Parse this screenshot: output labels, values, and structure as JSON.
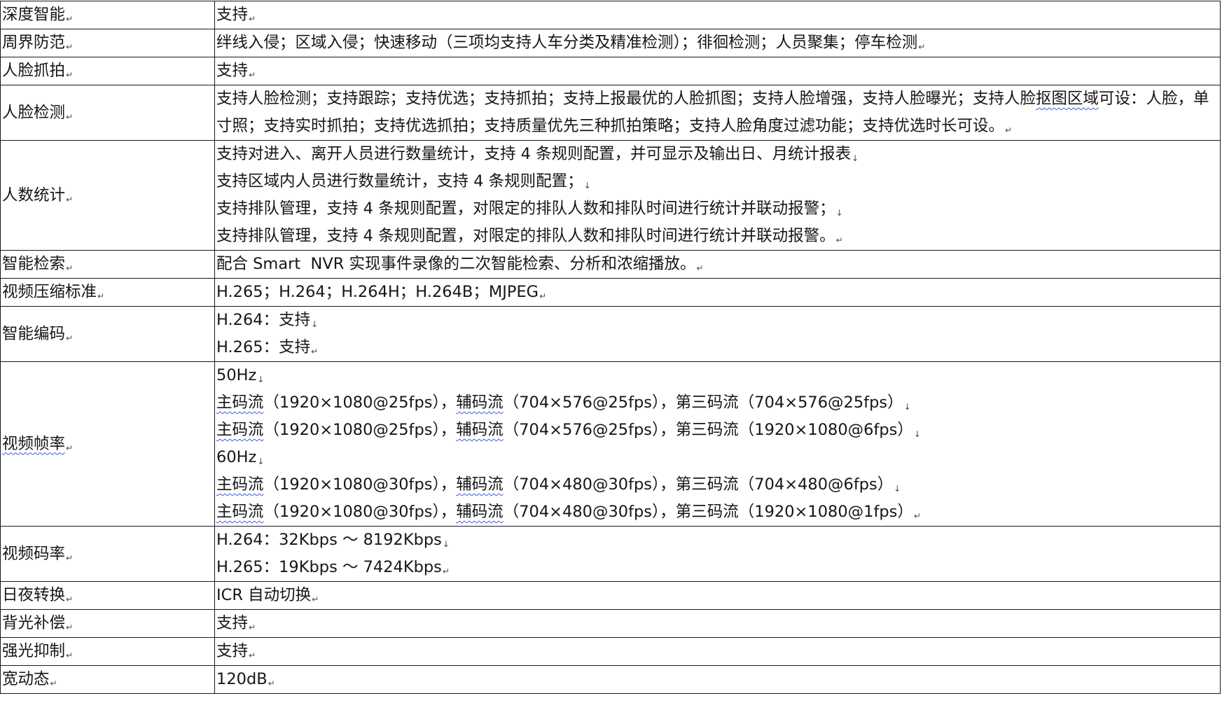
{
  "table": {
    "rows": [
      {
        "label": "深度智能",
        "lines": [
          "支持"
        ]
      },
      {
        "label": "周界防范",
        "lines": [
          "绊线入侵；区域入侵；快速移动（三项均支持人车分类及精准检测）；徘徊检测；人员聚集；停车检测"
        ]
      },
      {
        "label": "人脸抓拍",
        "lines": [
          "支持"
        ]
      },
      {
        "label": "人脸检测",
        "lines": [
          [
            "支持人脸检测；支持跟踪；支持优选；支持抓拍；支持上报最优的人脸抓图；支持人脸增强，支持人脸曝光；支持人脸",
            "抠图区域",
            "可设：人脸，单寸照；支持实时抓拍；支持优选抓拍；支持质量优先三种抓拍策略；支持人脸角度过滤功能；支持优选时长可设。"
          ]
        ]
      },
      {
        "label": "人数统计",
        "lines": [
          "支持对进入、离开人员进行数量统计，支持 4 条规则配置，并可显示及输出日、月统计报表",
          "支持区域内人员进行数量统计，支持 4 条规则配置；",
          "支持排队管理，支持 4 条规则配置，对限定的排队人数和排队时间进行统计并联动报警；",
          "支持排队管理，支持 4 条规则配置，对限定的排队人数和排队时间进行统计并联动报警。"
        ]
      },
      {
        "label": "智能检索",
        "lines": [
          "配合 Smart  NVR 实现事件录像的二次智能检索、分析和浓缩播放。"
        ]
      },
      {
        "label": "视频压缩标准",
        "lines": [
          "H.265；H.264；H.264H；H.264B；MJPEG"
        ]
      },
      {
        "label": "智能编码",
        "lines": [
          "H.264：支持",
          "H.265：支持"
        ]
      },
      {
        "label": "视频帧率",
        "lines": [
          "50Hz",
          [
            "主码流",
            "（1920×1080@25fps），",
            "辅码流",
            "（704×576@25fps），第三码流（704×576@25fps）"
          ],
          [
            "主码流",
            "（1920×1080@25fps），",
            "辅码流",
            "（704×576@25fps），第三码流（1920×1080@6fps）"
          ],
          "60Hz",
          [
            "主码流",
            "（1920×1080@30fps），",
            "辅码流",
            "（704×480@30fps），第三码流（704×480@6fps）"
          ],
          [
            "主码流",
            "（1920×1080@30fps），",
            "辅码流",
            "（704×480@30fps），第三码流（1920×1080@1fps）"
          ]
        ]
      },
      {
        "label": "视频码率",
        "lines": [
          "H.264：32Kbps ～ 8192Kbps",
          "H.265：19Kbps ～ 7424Kbps"
        ]
      },
      {
        "label": "日夜转换",
        "lines": [
          "ICR 自动切换"
        ]
      },
      {
        "label": "背光补偿",
        "lines": [
          "支持"
        ]
      },
      {
        "label": "强光抑制",
        "lines": [
          "支持"
        ]
      },
      {
        "label": "宽动态",
        "lines": [
          "120dB"
        ]
      }
    ]
  }
}
